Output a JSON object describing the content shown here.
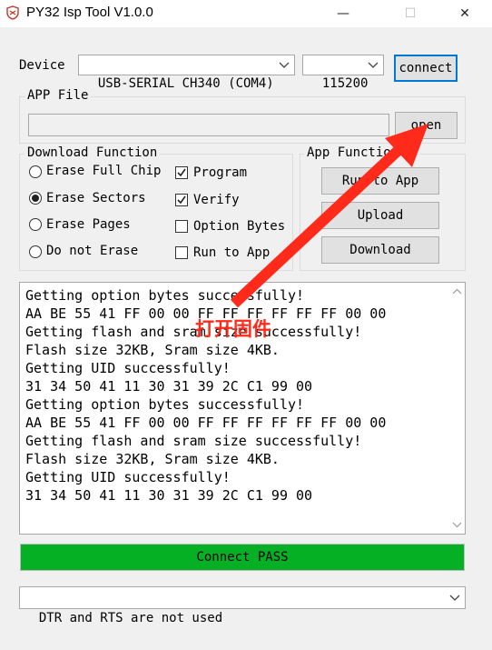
{
  "window": {
    "title": "PY32 Isp Tool V1.0.0",
    "minimize_glyph": "—",
    "maximize_glyph": "☐",
    "close_glyph": "✕"
  },
  "device": {
    "label": "Device",
    "port_value": "USB-SERIAL CH340 (COM4)",
    "baud_value": "115200",
    "connect_label": "connect"
  },
  "app_file": {
    "group_title": "APP File",
    "path_value": "",
    "open_label": "open"
  },
  "download_function": {
    "group_title": "Download Function",
    "radios": [
      {
        "label": "Erase Full Chip",
        "selected": false
      },
      {
        "label": "Erase Sectors",
        "selected": true
      },
      {
        "label": "Erase Pages",
        "selected": false
      },
      {
        "label": "Do not Erase",
        "selected": false
      }
    ],
    "checks": [
      {
        "label": "Program",
        "checked": true
      },
      {
        "label": "Verify",
        "checked": true
      },
      {
        "label": "Option Bytes",
        "checked": false
      },
      {
        "label": "Run to App",
        "checked": false
      }
    ]
  },
  "app_function": {
    "group_title": "App Function",
    "buttons": [
      "Run to App",
      "Upload",
      "Download"
    ]
  },
  "log": {
    "lines": [
      "Getting option bytes successfully!",
      "AA BE 55 41 FF 00 00 FF FF FF FF FF FF 00 00",
      "Getting flash and sram size successfully!",
      "Flash size 32KB, Sram size 4KB.",
      "Getting UID successfully!",
      "31 34 50 41 11 30 31 39 2C C1 99 00",
      "Getting option bytes successfully!",
      "AA BE 55 41 FF 00 00 FF FF FF FF FF FF 00 00",
      "Getting flash and sram size successfully!",
      "Flash size 32KB, Sram size 4KB.",
      "Getting UID successfully!",
      "31 34 50 41 11 30 31 39 2C C1 99 00"
    ]
  },
  "status": {
    "text": "Connect PASS",
    "color": "#06b025"
  },
  "bottom_select": {
    "value": "DTR and RTS are not used"
  },
  "annotation": {
    "text": "打开固件",
    "color": "#ff2a1a"
  },
  "icons": {
    "app": "app-logo-icon",
    "dropdown": "chevron-down-icon",
    "scroll_up": "scroll-up-arrow-icon",
    "scroll_down": "scroll-down-arrow-icon",
    "annotation_arrow": "red-arrow-icon"
  }
}
